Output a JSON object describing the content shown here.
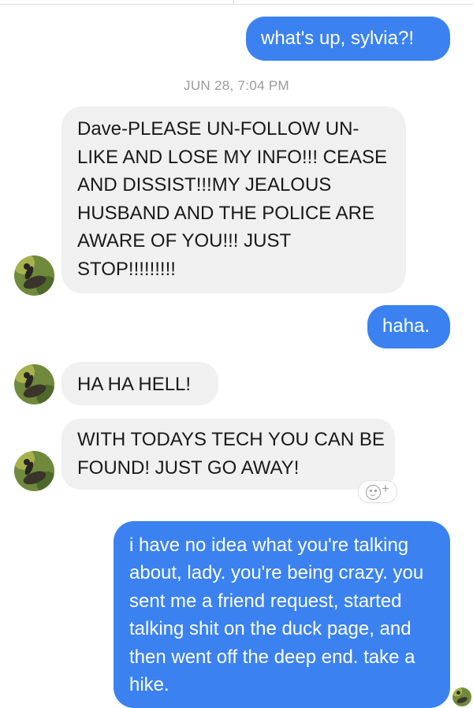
{
  "conversation": {
    "messages": [
      {
        "direction": "outgoing",
        "text": "what's up, sylvia?!"
      },
      {
        "direction": "incoming",
        "text": "Dave-PLEASE UN-FOLLOW UN-LIKE AND LOSE MY INFO!!! CEASE AND DISSIST!!!MY JEALOUS HUSBAND AND THE POLICE ARE AWARE OF YOU!!! JUST STOP!!!!!!!!!"
      },
      {
        "direction": "outgoing",
        "text": "haha."
      },
      {
        "direction": "incoming",
        "text": "HA HA HELL!"
      },
      {
        "direction": "incoming",
        "text": "WITH TODAYS TECH YOU CAN BE FOUND! JUST GO AWAY!"
      },
      {
        "direction": "outgoing",
        "text": "i have no idea what you're talking about, lady. you're being crazy. you sent me a friend request, started talking shit on the duck page, and then went off the deep end. take a hike."
      }
    ],
    "timestamp": "JUN 28, 7:04 PM",
    "react_button": {
      "icon": "add-reaction-icon",
      "plus": "+"
    }
  },
  "colors": {
    "outgoing_bubble": "#3b82f0",
    "incoming_bubble": "#f0f0f0",
    "timestamp": "#9a9a9a"
  }
}
